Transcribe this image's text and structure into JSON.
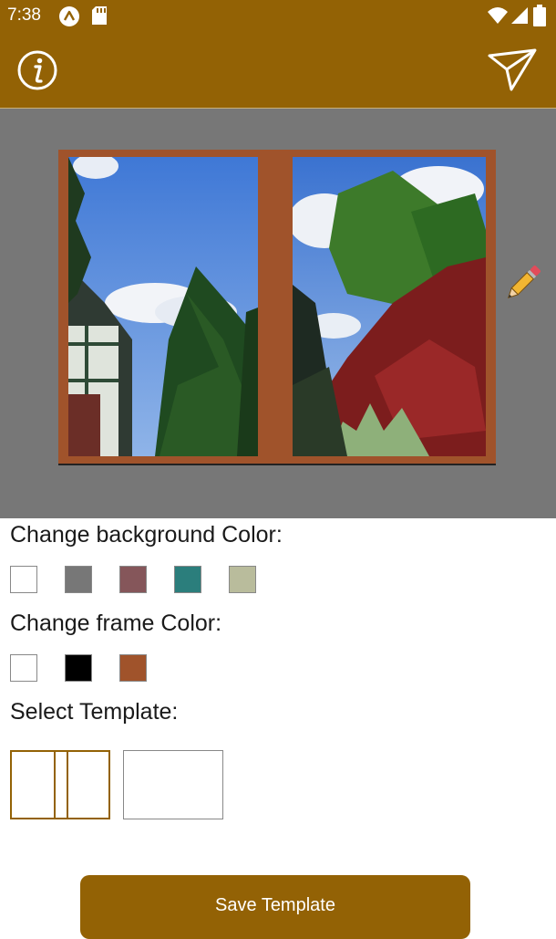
{
  "status_bar": {
    "time": "7:38",
    "icons": [
      "app-notification-icon",
      "sd-card-icon",
      "wifi-icon",
      "signal-icon",
      "battery-icon"
    ]
  },
  "app_bar": {
    "info_icon": "info-icon",
    "send_icon": "send-icon"
  },
  "preview": {
    "background_color": "#777777",
    "frame_color": "#a0532b",
    "edit_icon": "pencil-icon"
  },
  "background_color_section": {
    "label": "Change background Color:",
    "swatches": [
      "#ffffff",
      "#777777",
      "#85565a",
      "#2b7e7c",
      "#b9bc9c"
    ]
  },
  "frame_color_section": {
    "label": "Change frame Color:",
    "swatches": [
      "#ffffff",
      "#000000",
      "#a0532b"
    ]
  },
  "template_section": {
    "label": "Select Template:",
    "templates": [
      "two-panel",
      "single-panel"
    ],
    "selected": "two-panel",
    "selected_color": "#936205"
  },
  "save_button": {
    "label": "Save Template"
  },
  "colors": {
    "accent": "#936205"
  }
}
